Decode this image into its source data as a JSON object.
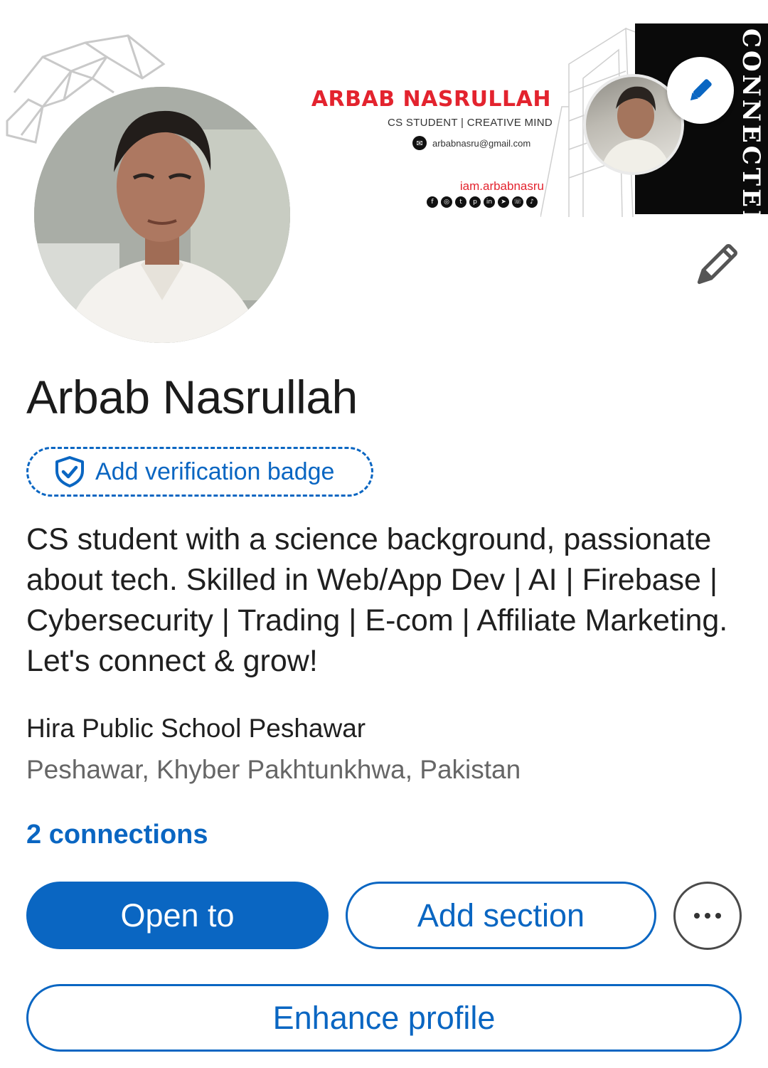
{
  "cover": {
    "name": "ARBAB NASRULLAH",
    "tagline": "CS STUDENT | CREATIVE MIND",
    "email": "arbabnasru@gmail.com",
    "handle": "iam.arbabnasru",
    "vertical_text": "CONNECTED",
    "socials": [
      "facebook-icon",
      "instagram-icon",
      "twitter-icon",
      "pinterest-icon",
      "linkedin-icon",
      "telegram-icon",
      "whatsapp-icon",
      "tiktok-icon"
    ]
  },
  "profile": {
    "name": "Arbab Nasrullah",
    "verification_label": "Add verification badge",
    "headline": "CS student with a science background, passionate about tech. Skilled in Web/App Dev | AI | Firebase | Cybersecurity | Trading | E-com | Affiliate Marketing. Let's connect & grow!",
    "school": "Hira Public School Peshawar",
    "location": "Peshawar, Khyber Pakhtunkhwa, Pakistan",
    "connections": "2 connections"
  },
  "actions": {
    "open_to": "Open to",
    "add_section": "Add section",
    "enhance_profile": "Enhance profile"
  },
  "colors": {
    "accent": "#0a66c2",
    "cover_red": "#e3232e",
    "cover_dark": "#0a0a0a"
  }
}
